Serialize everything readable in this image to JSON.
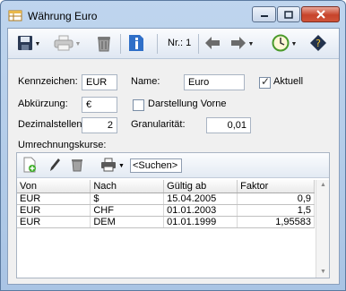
{
  "window": {
    "title": "Währung Euro"
  },
  "icons": {
    "app": "currency-table-icon",
    "save": "floppy-disk-icon",
    "print": "printer-icon",
    "delete": "trash-icon",
    "info": "info-icon",
    "prev": "arrow-left-icon",
    "next": "arrow-right-icon",
    "clock": "clock-icon",
    "help": "help-book-icon"
  },
  "toolbar": {
    "record_label": "Nr.: 1"
  },
  "form": {
    "kennzeichen_label": "Kennzeichen:",
    "kennzeichen_value": "EUR",
    "name_label": "Name:",
    "name_value": "Euro",
    "aktuell_label": "Aktuell",
    "aktuell_checked": true,
    "abkuerzung_label": "Abkürzung:",
    "abkuerzung_value": "€",
    "darstellung_label": "Darstellung Vorne",
    "darstellung_checked": false,
    "dezimal_label": "Dezimalstellen:",
    "dezimal_value": "2",
    "granularitaet_label": "Granularität:",
    "granularitaet_value": "0,01",
    "rates_label": "Umrechnungskurse:"
  },
  "rates": {
    "search_placeholder": "<Suchen>",
    "columns": [
      "Von",
      "Nach",
      "Gültig ab",
      "Faktor"
    ],
    "rows": [
      [
        "EUR",
        "$",
        "15.04.2005",
        "0,9"
      ],
      [
        "EUR",
        "CHF",
        "01.01.2003",
        "1,5"
      ],
      [
        "EUR",
        "DEM",
        "01.01.1999",
        "1,95583"
      ]
    ]
  }
}
